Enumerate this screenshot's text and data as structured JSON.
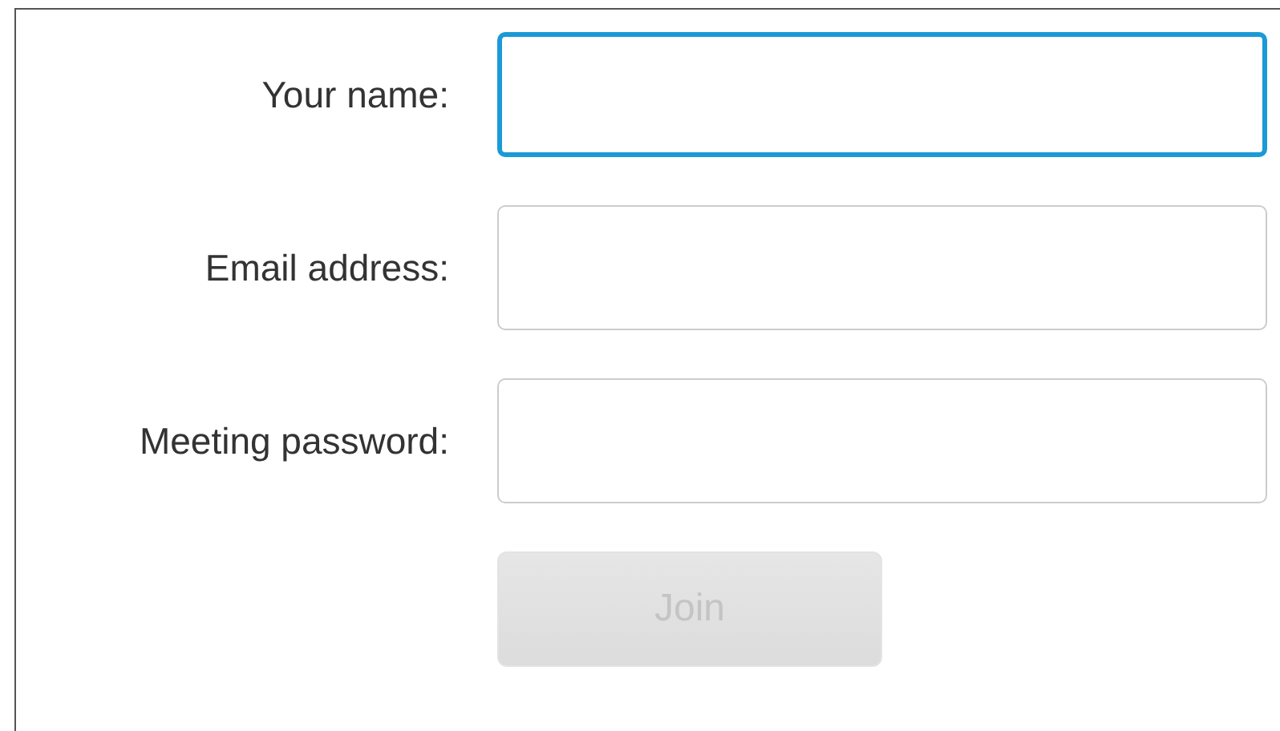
{
  "fields": [
    {
      "label": "Your name:",
      "focused": true
    },
    {
      "label": "Email address:",
      "focused": false
    },
    {
      "label": "Meeting password:",
      "focused": false
    }
  ],
  "join_button": {
    "label": "Join",
    "disabled": true
  }
}
